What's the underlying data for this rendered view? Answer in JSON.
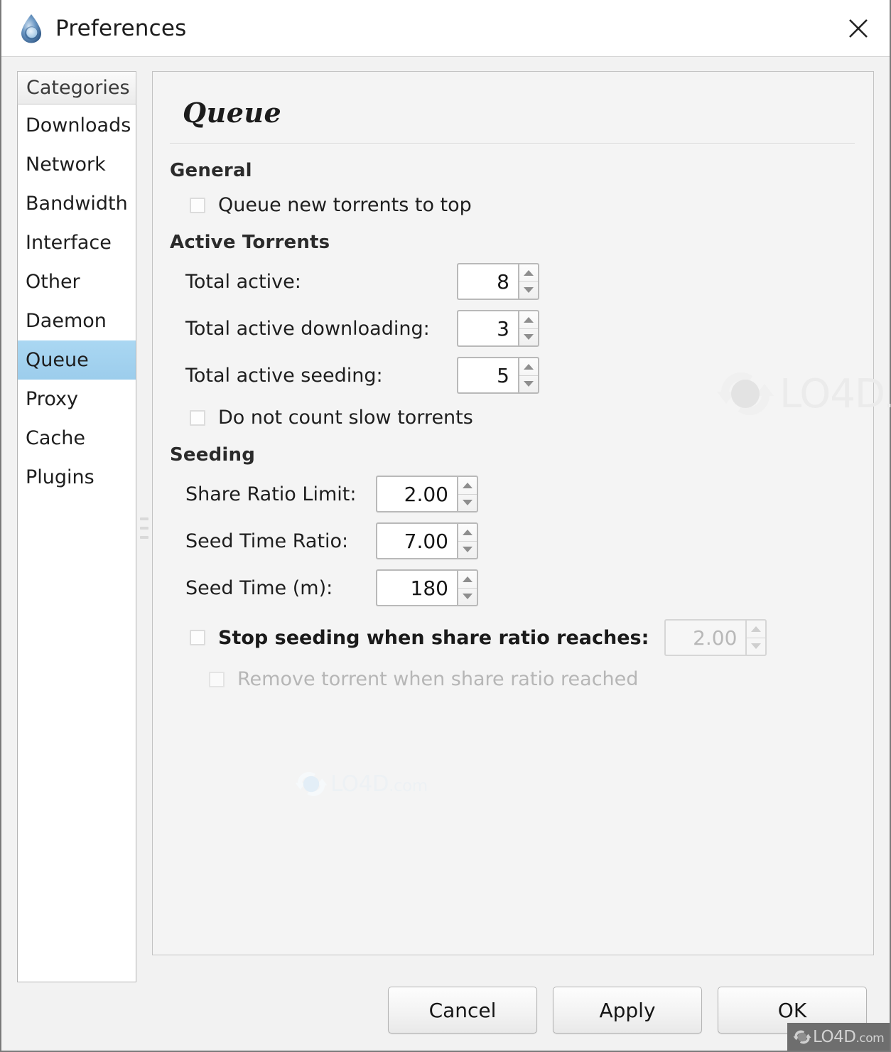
{
  "window": {
    "title": "Preferences",
    "app_icon": "deluge-droplet-icon",
    "close_icon": "close-icon"
  },
  "sidebar": {
    "header": "Categories",
    "items": [
      {
        "label": "Downloads",
        "selected": false
      },
      {
        "label": "Network",
        "selected": false
      },
      {
        "label": "Bandwidth",
        "selected": false
      },
      {
        "label": "Interface",
        "selected": false
      },
      {
        "label": "Other",
        "selected": false
      },
      {
        "label": "Daemon",
        "selected": false
      },
      {
        "label": "Queue",
        "selected": true
      },
      {
        "label": "Proxy",
        "selected": false
      },
      {
        "label": "Cache",
        "selected": false
      },
      {
        "label": "Plugins",
        "selected": false
      }
    ]
  },
  "panel": {
    "title": "Queue",
    "sections": {
      "general": {
        "heading": "General",
        "queue_new_to_top_label": "Queue new torrents to top",
        "queue_new_to_top_checked": false
      },
      "active_torrents": {
        "heading": "Active Torrents",
        "total_active_label": "Total active:",
        "total_active_value": "8",
        "total_active_downloading_label": "Total active downloading:",
        "total_active_downloading_value": "3",
        "total_active_seeding_label": "Total active seeding:",
        "total_active_seeding_value": "5",
        "do_not_count_slow_label": "Do not count slow torrents",
        "do_not_count_slow_checked": false
      },
      "seeding": {
        "heading": "Seeding",
        "share_ratio_limit_label": "Share Ratio Limit:",
        "share_ratio_limit_value": "2.00",
        "seed_time_ratio_label": "Seed Time Ratio:",
        "seed_time_ratio_value": "7.00",
        "seed_time_m_label": "Seed Time (m):",
        "seed_time_m_value": "180",
        "stop_seeding_label": "Stop seeding when share ratio reaches:",
        "stop_seeding_checked": false,
        "stop_seeding_value": "2.00",
        "stop_seeding_value_disabled": true,
        "remove_torrent_label": "Remove torrent when share ratio reached",
        "remove_torrent_checked": false,
        "remove_torrent_disabled": true
      }
    }
  },
  "footer": {
    "cancel_label": "Cancel",
    "apply_label": "Apply",
    "ok_label": "OK"
  },
  "watermark": {
    "text_main": "LO4D",
    "text_suffix": ".com",
    "logo_icon": "lo4d-refresh-logo-icon"
  },
  "colors": {
    "selection_blue": "#a3d2ef",
    "dialog_bg": "#f2f2f2",
    "panel_bg": "#f4f4f4",
    "accent_logo_blue": "#4a7eb5",
    "disabled_text": "#b6b6b6"
  }
}
